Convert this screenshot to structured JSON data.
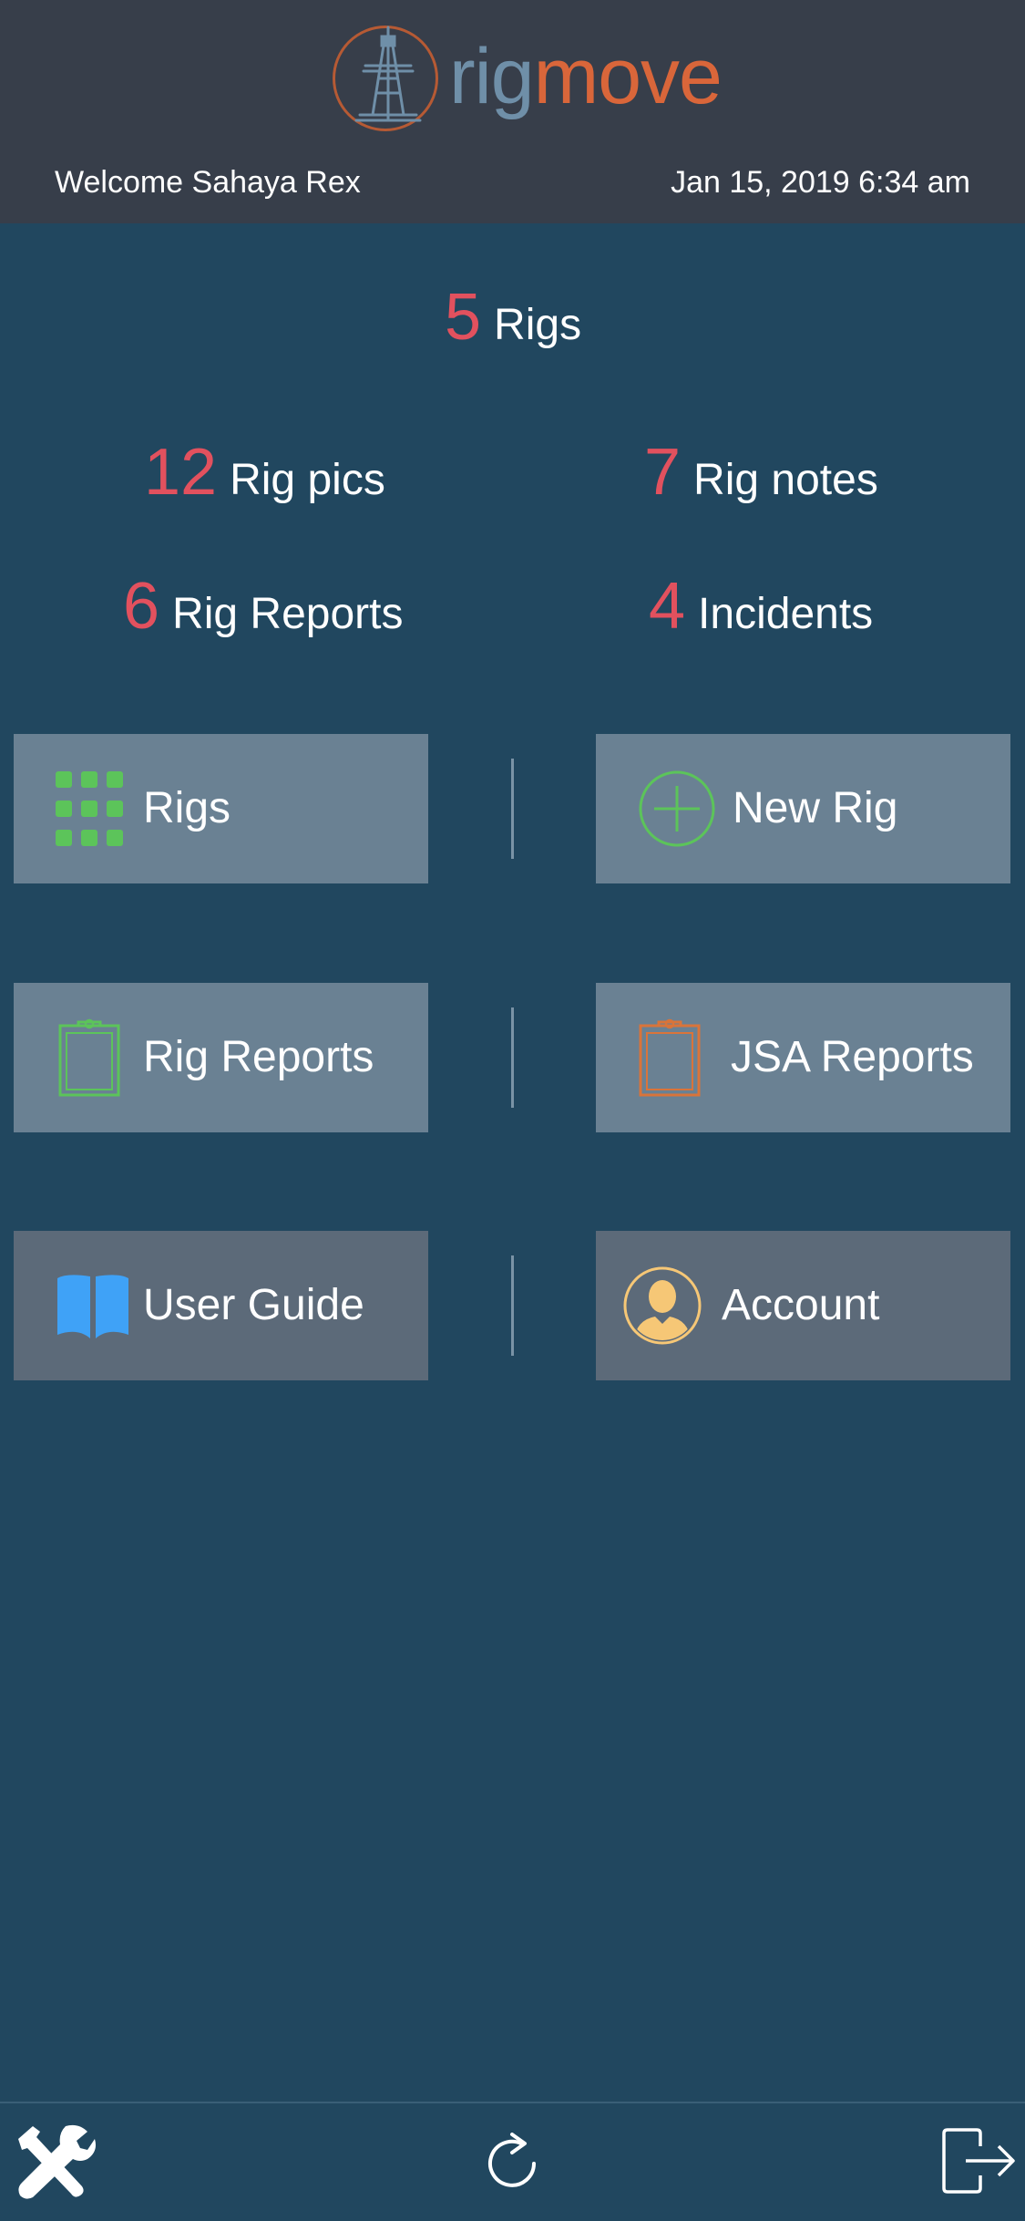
{
  "app": {
    "logo_part1": "rig",
    "logo_part2": "move"
  },
  "header": {
    "welcome": "Welcome Sahaya Rex",
    "datetime": "Jan 15, 2019 6:34 am"
  },
  "stats": {
    "rigs": {
      "count": "5",
      "label": "Rigs"
    },
    "rig_pics": {
      "count": "12",
      "label": "Rig pics"
    },
    "rig_notes": {
      "count": "7",
      "label": "Rig notes"
    },
    "rig_reports": {
      "count": "6",
      "label": "Rig Reports"
    },
    "incidents": {
      "count": "4",
      "label": "Incidents"
    }
  },
  "tiles": {
    "rigs": {
      "label": "Rigs",
      "icon": "grid-icon"
    },
    "new_rig": {
      "label": "New Rig",
      "icon": "plus-circle-icon"
    },
    "rig_reports": {
      "label": "Rig Reports",
      "icon": "clipboard-icon"
    },
    "jsa_reports": {
      "label": "JSA Reports",
      "icon": "clipboard-icon"
    },
    "user_guide": {
      "label": "User Guide",
      "icon": "book-icon"
    },
    "account": {
      "label": "Account",
      "icon": "user-icon"
    }
  },
  "footer": {
    "tools_icon": "tools-icon",
    "refresh_icon": "refresh-icon",
    "logout_icon": "logout-icon"
  },
  "colors": {
    "background": "#21475f",
    "header": "#373e4a",
    "stat_number": "#e2515e",
    "tile": "#6a8193",
    "tile_dark": "#5c6a79",
    "green": "#5cc45a",
    "orange": "#d9743a",
    "blue": "#3fa2f7",
    "yellow": "#f6c776"
  }
}
